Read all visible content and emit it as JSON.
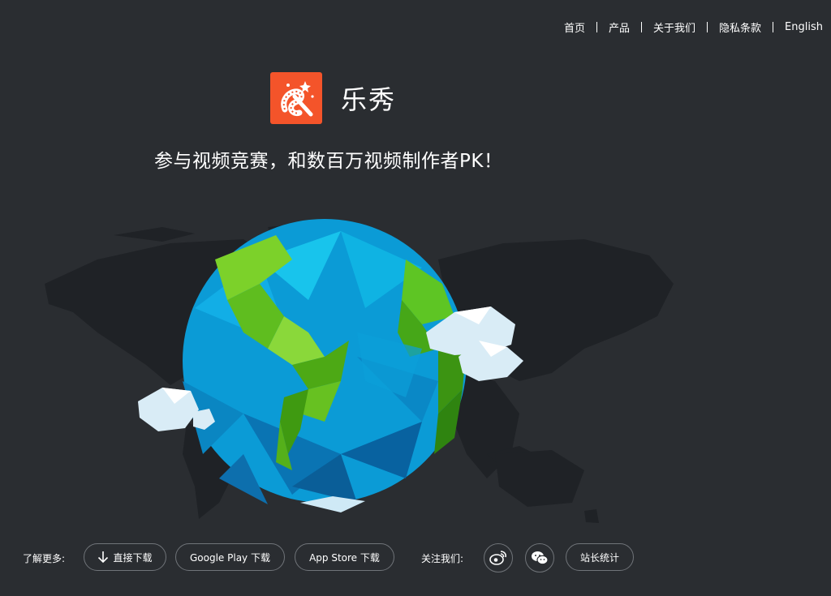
{
  "nav": {
    "items": [
      "首页",
      "产品",
      "关于我们",
      "隐私条款",
      "English"
    ]
  },
  "brand": {
    "app_name": "乐秀",
    "logo_icon": "magic-wand-film-icon",
    "logo_color": "#f4542a"
  },
  "tagline": "参与视频竞赛，和数百万视频制作者PK！",
  "footer": {
    "learn_more_label": "了解更多:",
    "direct_download": "直接下载",
    "google_play": "Google Play 下载",
    "app_store": "App Store 下载",
    "follow_label": "关注我们:",
    "weibo_icon": "weibo-icon",
    "wechat_icon": "wechat-icon",
    "stats": "站长统计"
  },
  "colors": {
    "background": "#2a2d31",
    "ocean": "#0b9bd6",
    "land": "#5ec524",
    "cloud": "#d9ecf6"
  }
}
